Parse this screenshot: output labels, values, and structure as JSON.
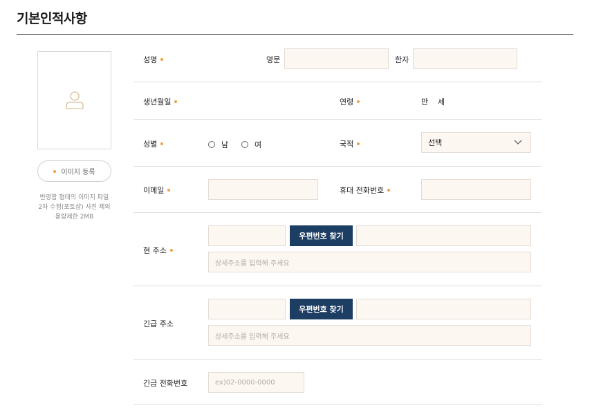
{
  "page": {
    "title": "기본인적사항"
  },
  "photo": {
    "upload_label": "이미지 등록",
    "notes": [
      "반영함 형태의 이미지 파일",
      "2차 수정(포토샵) 사진 제외",
      "용량제한 2MB"
    ]
  },
  "labels": {
    "name": "성명",
    "english": "영문",
    "hanja": "한자",
    "birth": "생년월일",
    "age": "연령",
    "age_value": "만",
    "age_unit": "세",
    "gender": "성별",
    "male": "남",
    "female": "여",
    "nationality": "국적",
    "email": "이메일",
    "mobile": "휴대 전화번호",
    "address": "현 주소",
    "emergency_address": "긴급 주소",
    "emergency_phone": "긴급 전화번호"
  },
  "select": {
    "nationality_value": "선택"
  },
  "buttons": {
    "zip_search": "우편번호 찾기",
    "zip_search_2": "우편번호 찾기"
  },
  "placeholders": {
    "address_detail": "상세주소를 입력해 주세요",
    "emergency_address_detail": "상세주소를 입력해 주세요",
    "emergency_phone": "ex)02-0000-0000"
  },
  "colors": {
    "accent_dot": "#f0a040",
    "button": "#1d3e63",
    "input_bg": "#fdf7f2"
  }
}
